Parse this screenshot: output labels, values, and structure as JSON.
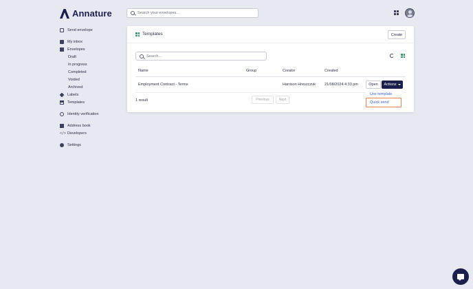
{
  "app": {
    "name": "Annature"
  },
  "header": {
    "search_placeholder": "Search your envelopes..."
  },
  "sidebar": {
    "send_envelope": "Send envelope",
    "my_inbox": "My inbox",
    "envelopes": "Envelopes",
    "draft": "Draft",
    "in_progress": "In progress",
    "completed": "Completed",
    "voided": "Voided",
    "archived": "Archived",
    "labels": "Labels",
    "templates": "Templates",
    "identity_verification": "Identity verification",
    "address_book": "Address book",
    "developers": "Developers",
    "settings": "Settings"
  },
  "card": {
    "title": "Templates",
    "create_label": "Create",
    "search_placeholder": "Search...",
    "columns": {
      "name": "Name",
      "group": "Group",
      "creator": "Creator",
      "created": "Created"
    },
    "rows": [
      {
        "name": "Employment Contract - Terms",
        "group": "",
        "creator": "Harrison Hreszczuk",
        "created": "21/08/2024 4:33 pm"
      }
    ],
    "open_label": "Open",
    "actions_label": "Actions",
    "dropdown": {
      "use_template": "Use template",
      "quick_send": "Quick send"
    },
    "result_count": "1 result",
    "previous_label": "Previous",
    "next_label": "Next"
  },
  "colors": {
    "brand": "#1b1f4b",
    "accent_green": "#3a9a6a",
    "link": "#3a63c8",
    "highlight": "#e8824e",
    "background": "#e6e9f0"
  },
  "icons": [
    "logo-mark-icon",
    "search-icon",
    "apps-icon",
    "avatar",
    "send-icon",
    "inbox-icon",
    "envelope-icon",
    "label-icon",
    "template-icon",
    "eye-icon",
    "book-icon",
    "code-icon",
    "gear-icon",
    "refresh-icon",
    "grid-icon",
    "chevron-down-icon",
    "chat-icon"
  ]
}
